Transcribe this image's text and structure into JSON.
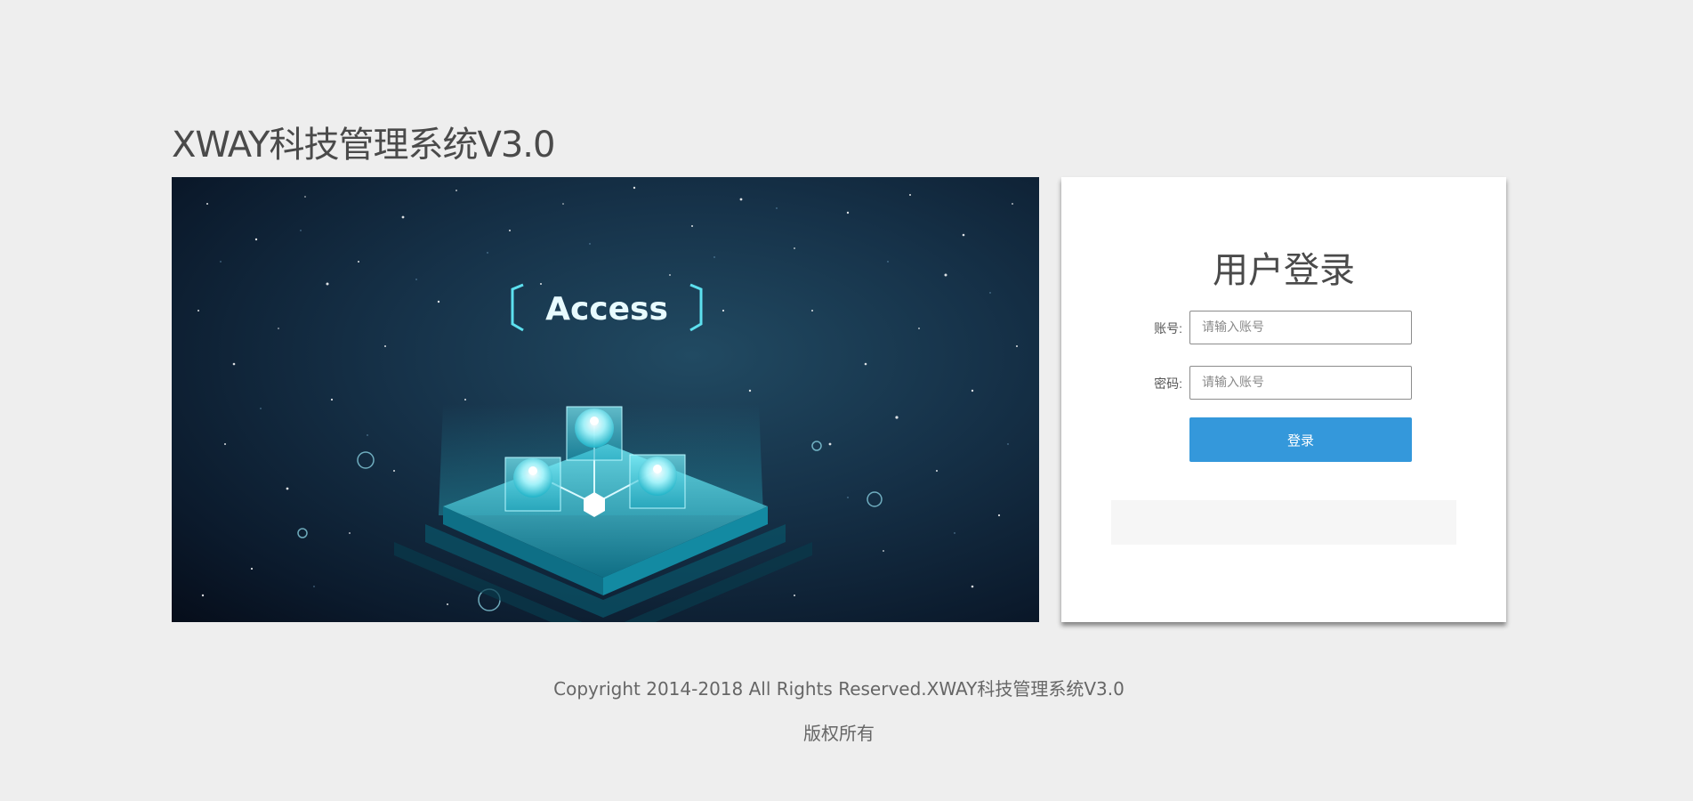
{
  "app": {
    "title": "XWAY科技管理系统V3.0"
  },
  "banner": {
    "caption": "Access"
  },
  "login": {
    "title": "用户登录",
    "account_label": "账号:",
    "account_placeholder": "请输入账号",
    "password_label": "密码:",
    "password_placeholder": "请输入账号",
    "submit_label": "登录"
  },
  "footer": {
    "copyright": "Copyright 2014-2018 All Rights Reserved.XWAY科技管理系统V3.0",
    "rights": "版权所有"
  },
  "colors": {
    "background": "#eeeeee",
    "accent": "#3498db",
    "panel": "#ffffff"
  }
}
